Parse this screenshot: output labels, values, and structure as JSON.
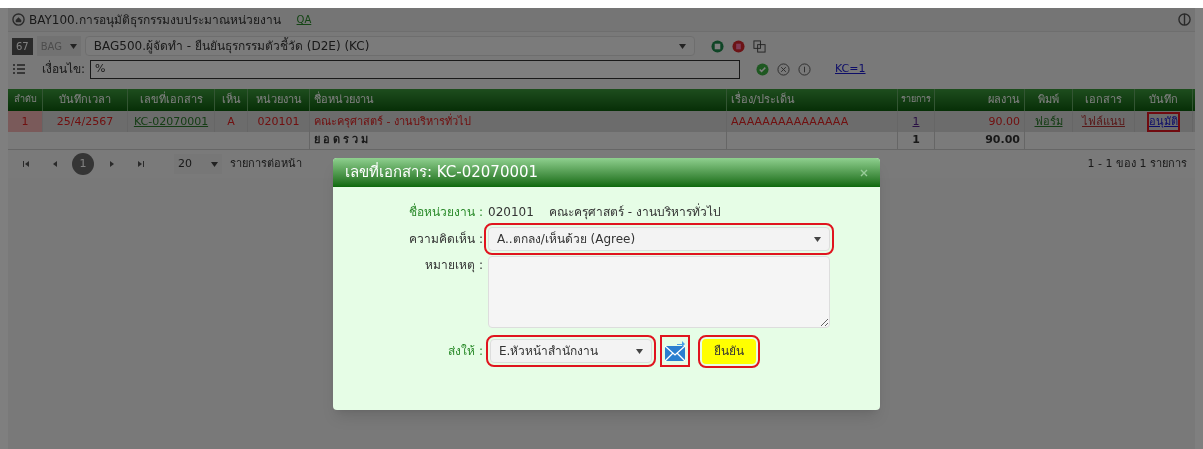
{
  "window": {
    "title": "BAY100.การอนุมัติธุรกรรมงบประมาณหน่วยงาน",
    "tag": "QA"
  },
  "toolbar": {
    "year": "67",
    "module": "BAG",
    "report": "BAG500.ผู้จัดทำ - ยืนยันธุรกรรมตัวชี้วัด (D2E) (KC)",
    "condition_label": "เงื่อนไข:",
    "condition_value": "%",
    "filter_link": "KC=1"
  },
  "table": {
    "columns": [
      "ลำดับ",
      "บันทึกเวลา",
      "เลขที่เอกสาร",
      "เห็น",
      "หน่วยงาน",
      "ชื่อหน่วยงาน",
      "เรื่อง/ประเด็น",
      "รายการ",
      "ผลงาน",
      "พิมพ์",
      "เอกสาร",
      "บันทึก"
    ],
    "rows": [
      {
        "selected": true,
        "cells": [
          "1",
          "25/4/2567",
          "KC-02070001",
          "A",
          "020101",
          "คณะครุศาสตร์ - งานบริหารทั่วไป",
          "AAAAAAAAAAAAAAA",
          "1",
          "90.00",
          "ฟอร์ม",
          "ไฟล์แนบ",
          "อนุมัติ"
        ],
        "action_highlighted": true
      }
    ],
    "total": {
      "label": "ยอดรวม",
      "count": "1",
      "amount": "90.00"
    }
  },
  "pager": {
    "pages": [
      {
        "label": "1",
        "selected": true
      }
    ],
    "page_size": "20",
    "page_size_label": "รายการต่อหน้า",
    "summary": "1 - 1 ของ 1 รายการ"
  },
  "dialog": {
    "title": "เลขที่เอกสาร: KC-02070001",
    "unit_label": "ชื่อหน่วยงาน :",
    "unit_code": "020101",
    "unit_name": "คณะครุศาสตร์ - งานบริหารทั่วไป",
    "opinion_label": "ความคิดเห็น :",
    "opinion_value": "A..ตกลง/เห็นด้วย (Agree)",
    "opinion_highlighted": true,
    "note_label": "หมายเหตุ :",
    "send_label": "ส่งให้ :",
    "send_value": "E.หัวหน้าสำนักงาน",
    "send_highlighted": true,
    "mail_highlighted": true,
    "confirm": "ยืนยัน",
    "confirm_highlighted": true
  }
}
